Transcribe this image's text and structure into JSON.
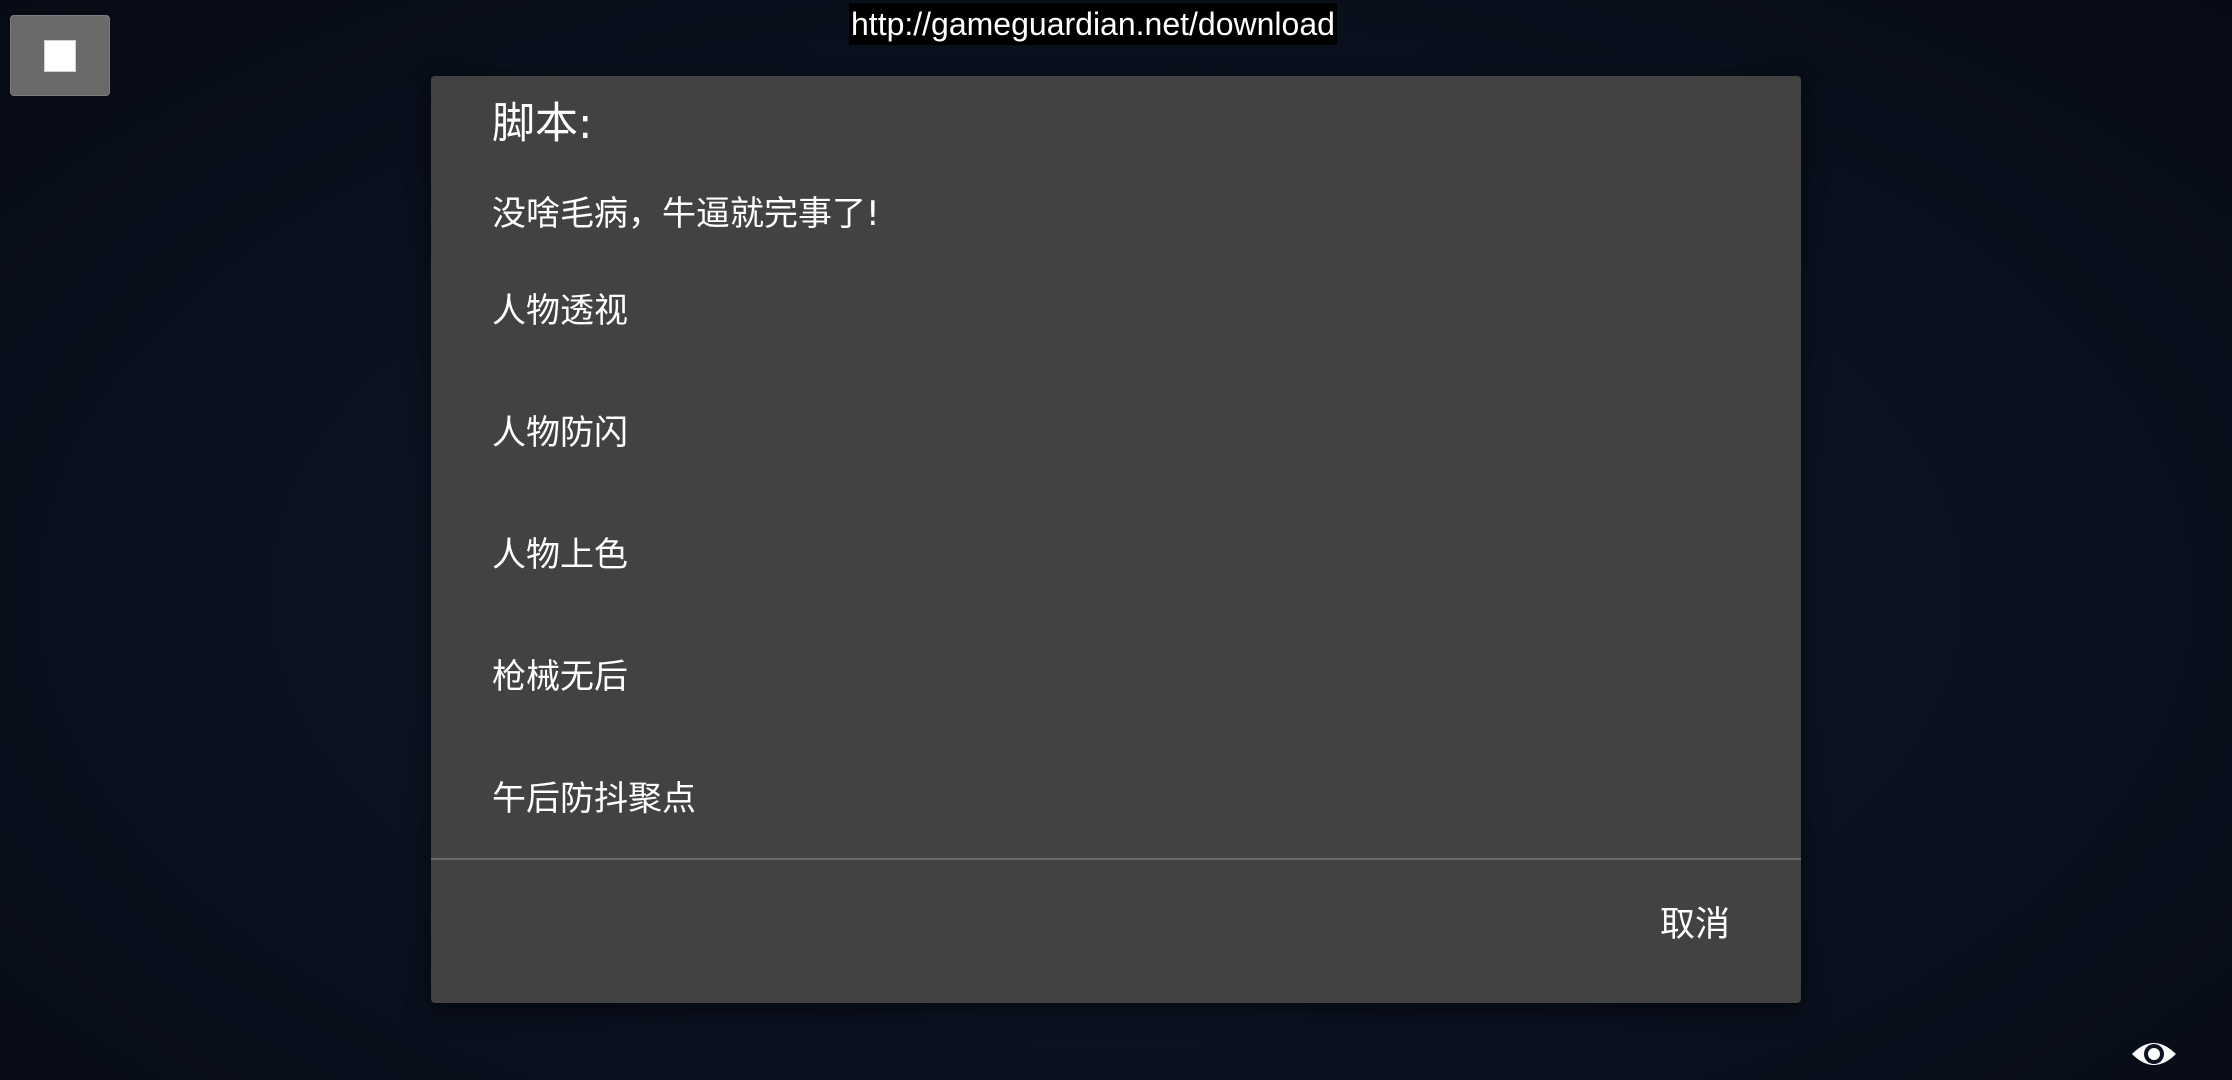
{
  "overlay": {
    "url": "http://gameguardian.net/download",
    "stop_icon": "stop-square-icon",
    "visibility_icon": "eye-icon"
  },
  "dialog": {
    "title": "脚本:",
    "message": "没啥毛病，牛逼就完事了!",
    "items": [
      {
        "label": "人物透视"
      },
      {
        "label": "人物防闪"
      },
      {
        "label": "人物上色"
      },
      {
        "label": "枪械无后"
      },
      {
        "label": "午后防抖聚点"
      }
    ],
    "cancel_label": "取消"
  },
  "colors": {
    "dialog_bg": "#424242",
    "screen_bg": "#0b1120",
    "text": "#ffffff"
  }
}
